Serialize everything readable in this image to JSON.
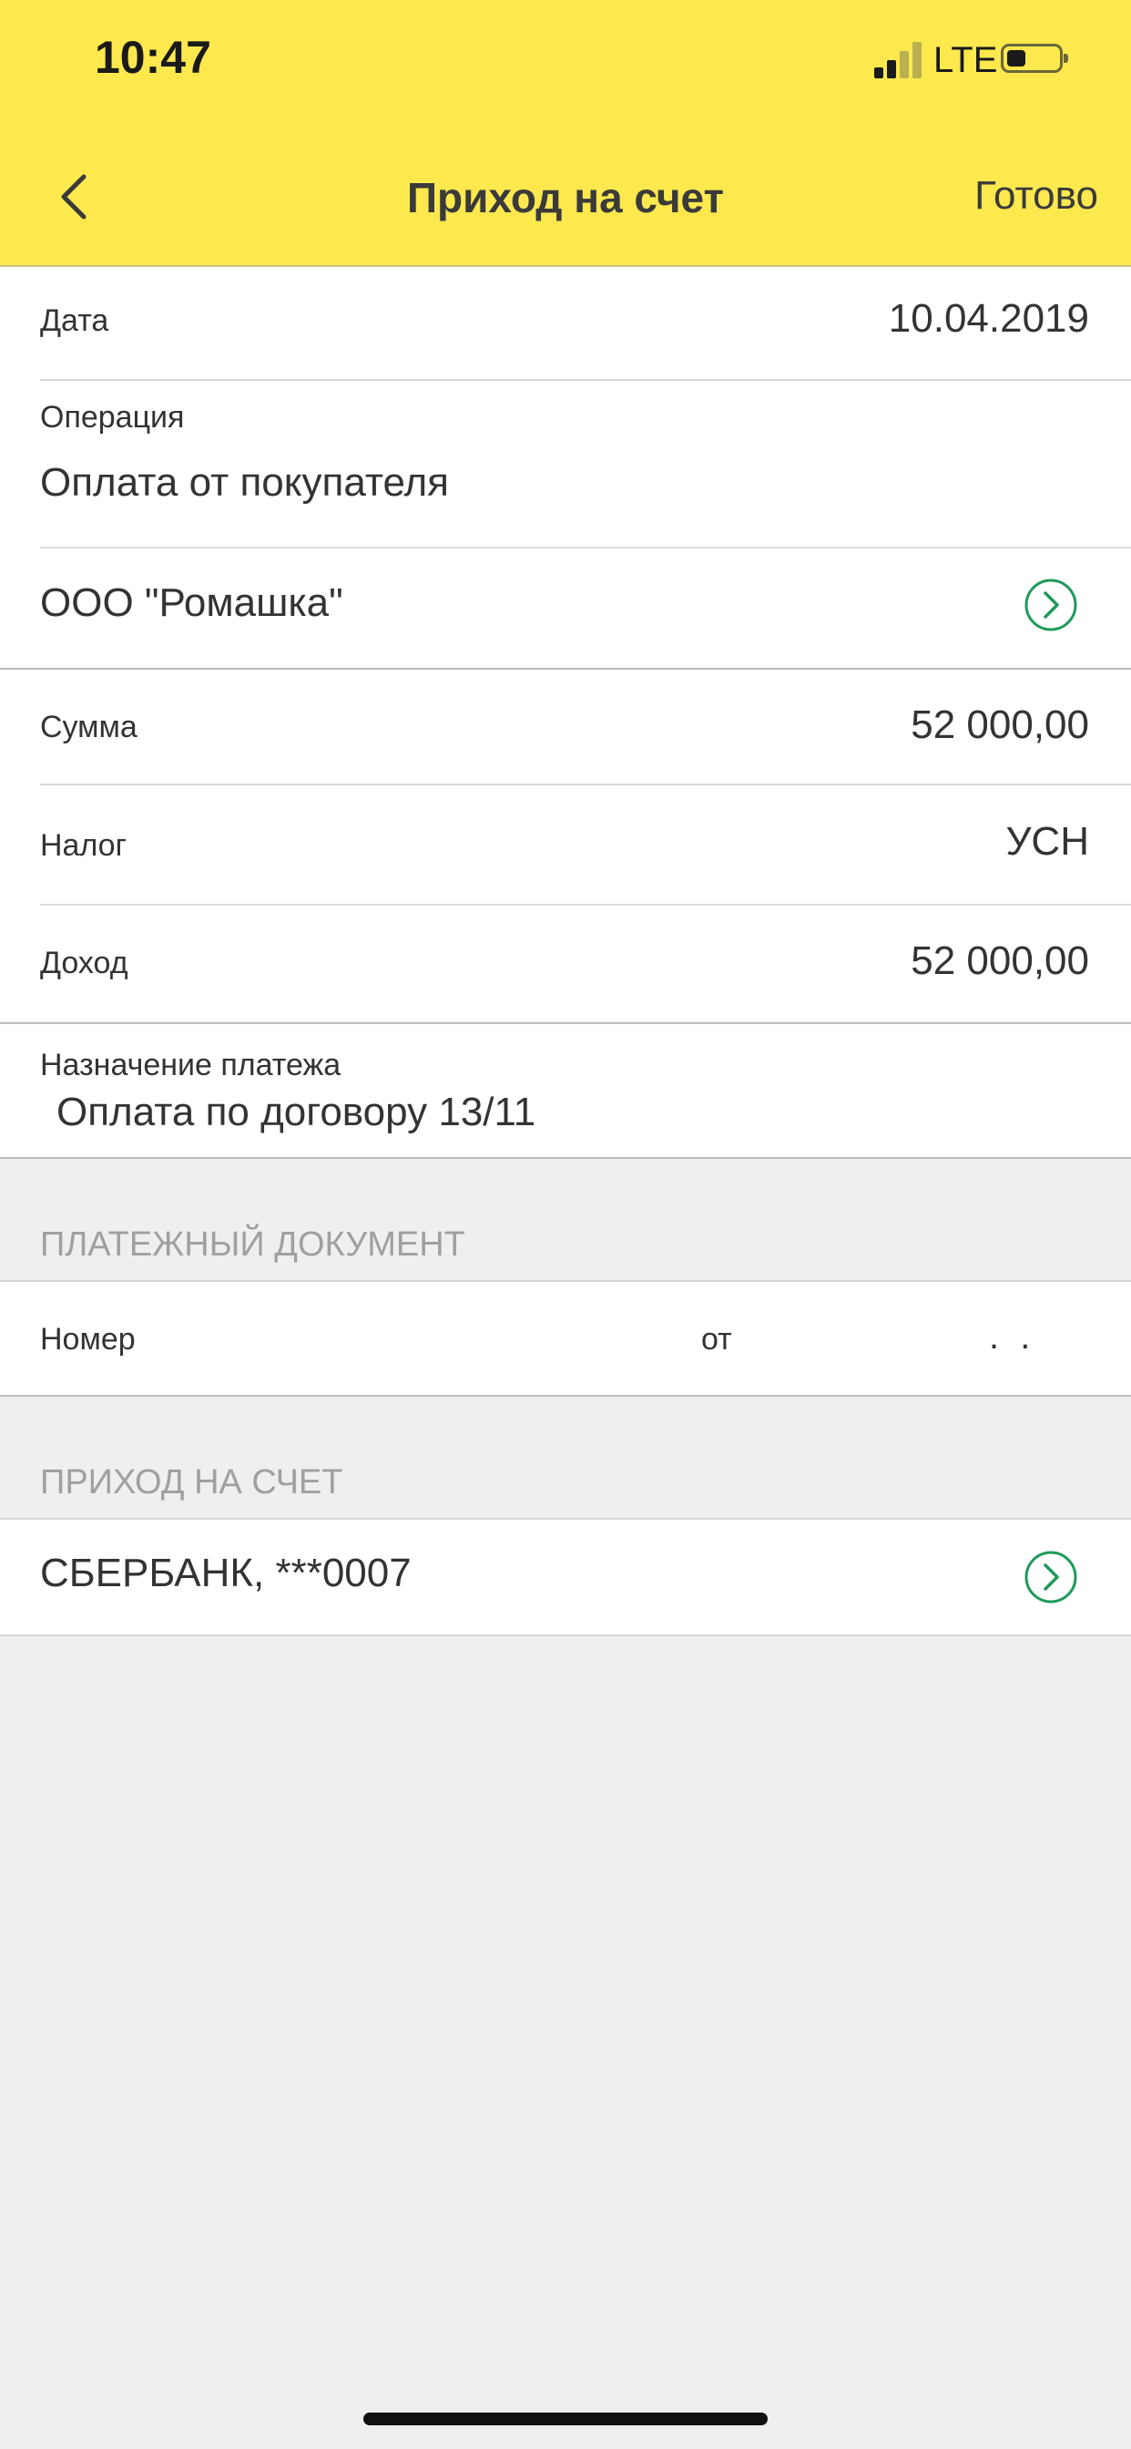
{
  "status_bar": {
    "time": "10:47",
    "network": "LTE"
  },
  "nav": {
    "title": "Приход на счет",
    "done_label": "Готово"
  },
  "form": {
    "date_label": "Дата",
    "date_value": "10.04.2019",
    "operation_label": "Операция",
    "operation_value": "Оплата от покупателя",
    "counterparty_value": "ООО \"Ромашка\"",
    "sum_label": "Сумма",
    "sum_value": "52 000,00",
    "tax_label": "Налог",
    "tax_value": "УСН",
    "income_label": "Доход",
    "income_value": "52 000,00",
    "purpose_label": "Назначение платежа",
    "purpose_value": "Оплата по договору 13/11"
  },
  "payment_document": {
    "header": "ПЛАТЕЖНЫЙ ДОКУМЕНТ",
    "number_label": "Номер",
    "from_label": "от",
    "date_placeholder": ". ."
  },
  "account": {
    "header": "ПРИХОД НА СЧЕТ",
    "value": "СБЕРБАНК, ***0007"
  },
  "colors": {
    "nav_background": "#fde84e",
    "chevron_accent": "#1f9a5a"
  },
  "icons": {
    "back": "chevron-left-icon",
    "row_link": "chevron-right-circle-icon"
  }
}
